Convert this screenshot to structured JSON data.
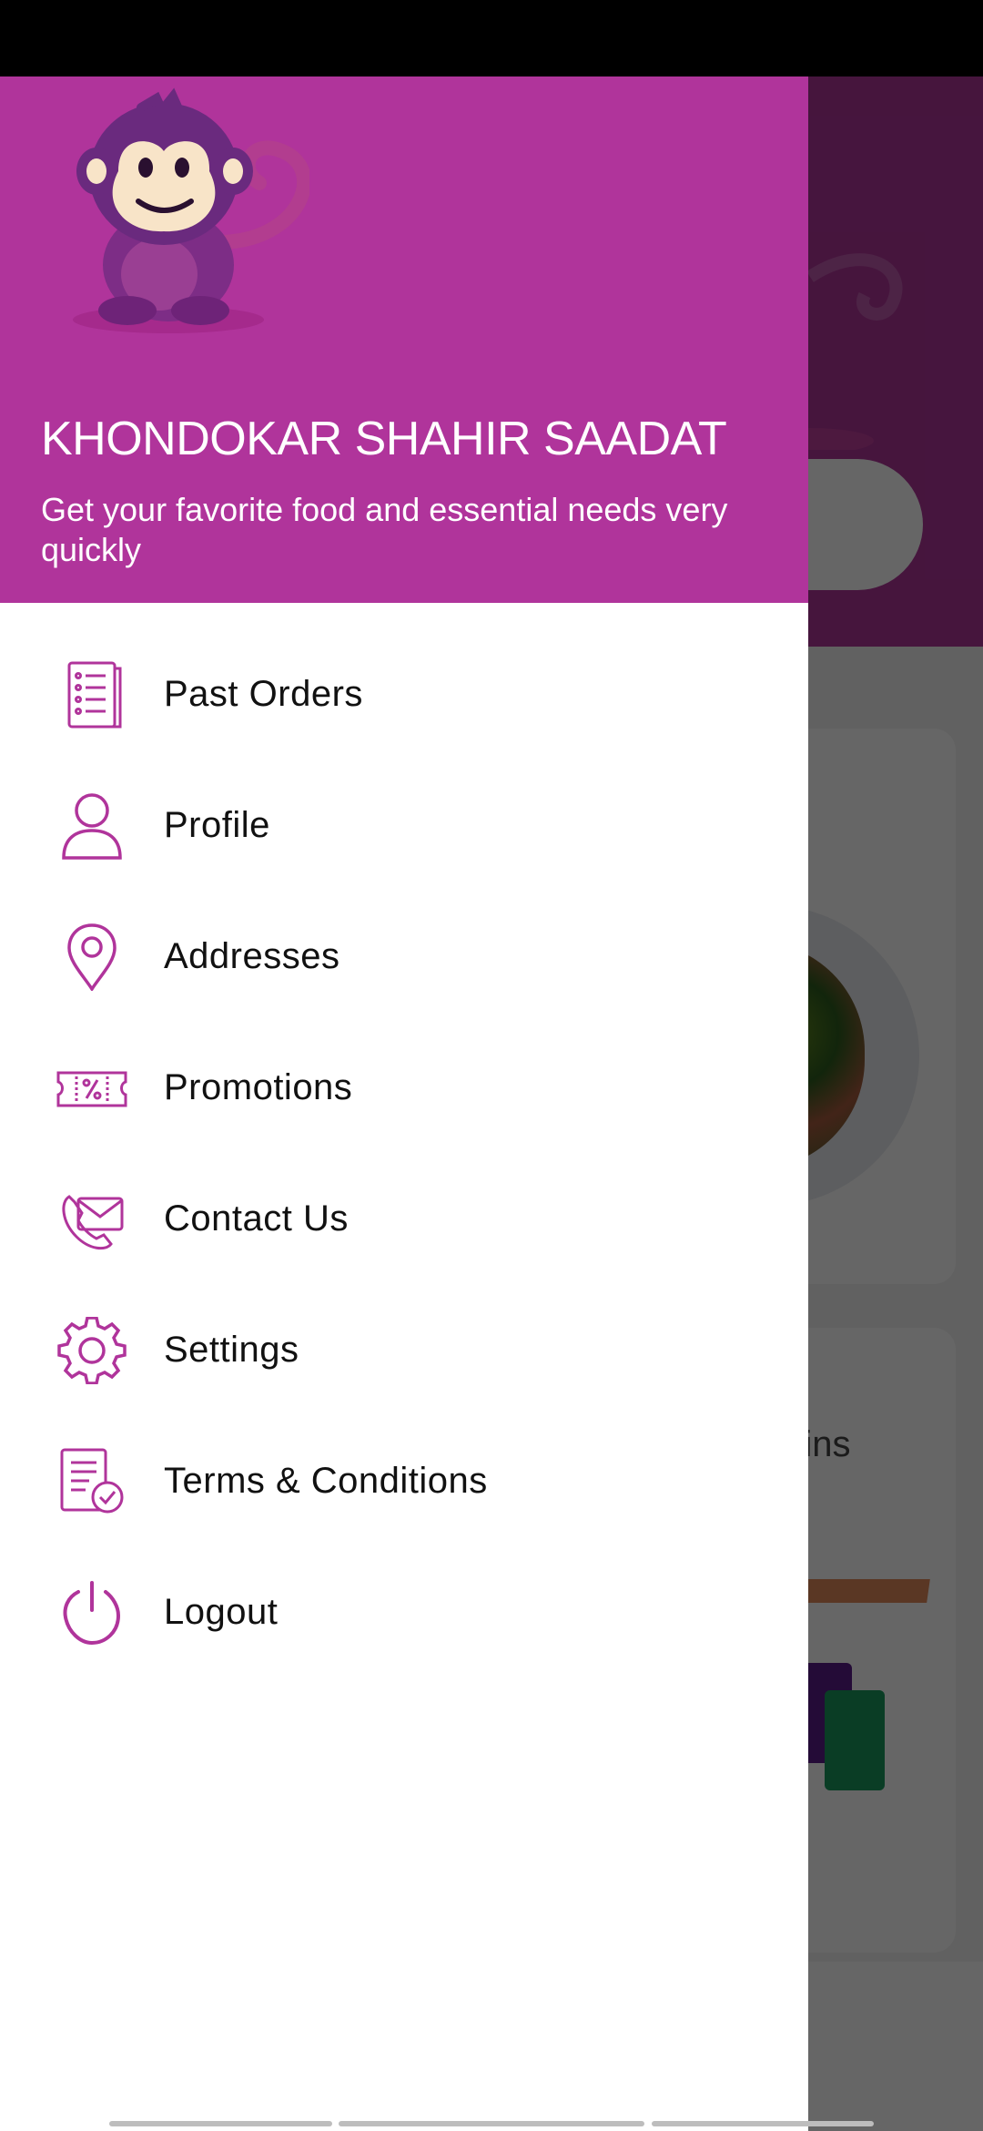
{
  "drawer": {
    "user_name": "KHONDOKAR SHAHIR SAADAT",
    "tagline": "Get your favorite food and essential needs very quickly",
    "items": [
      {
        "label": "Past Orders",
        "icon": "receipt-list-icon"
      },
      {
        "label": "Profile",
        "icon": "person-icon"
      },
      {
        "label": "Addresses",
        "icon": "location-pin-icon"
      },
      {
        "label": "Promotions",
        "icon": "discount-ticket-icon"
      },
      {
        "label": "Contact Us",
        "icon": "phone-mail-icon"
      },
      {
        "label": "Settings",
        "icon": "gear-icon"
      },
      {
        "label": "Terms & Conditions",
        "icon": "document-check-icon"
      },
      {
        "label": "Logout",
        "icon": "power-icon"
      }
    ]
  },
  "background": {
    "mins_text": "mins"
  },
  "colors": {
    "brand": "#b0349b",
    "icon": "#b0349b",
    "scrim": "rgba(0,0,0,0.6)"
  }
}
